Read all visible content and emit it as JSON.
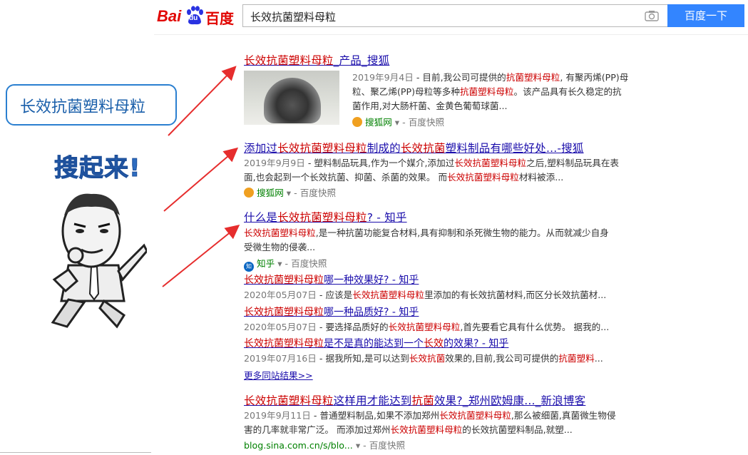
{
  "logo": {
    "bai": "Bai",
    "du": "du",
    "cn": "百度"
  },
  "search": {
    "query": "长效抗菌塑料母粒",
    "button": "百度一下"
  },
  "side": {
    "bubble": "长效抗菌塑料母粒",
    "meme_text": "搜起来!"
  },
  "results": {
    "r1": {
      "title": [
        "长效抗菌塑料母粒",
        "_产品_搜狐"
      ],
      "line1": [
        "2019年9月4日",
        " - 目前,我公司可提供的",
        "抗菌塑料母粒",
        ", 有聚丙烯(PP)母"
      ],
      "line2": [
        "粒、聚乙烯(PP)母粒等多种",
        "抗菌塑料母粒",
        "。该产品具有长久稳定的抗"
      ],
      "line3": "菌作用,对大肠杆菌、金黄色葡萄球菌...",
      "source": "搜狐网",
      "snapshot": "百度快照"
    },
    "r2": {
      "title": [
        "添加过",
        "长效抗菌塑料母粒",
        "制成的",
        "长效抗菌",
        "塑料制品有哪些好处...-搜狐"
      ],
      "line1": [
        "2019年9月9日",
        " - 塑料制品玩具,作为一个媒介,添加过",
        "长效抗菌塑料母粒",
        "之后,塑料制品玩具在表"
      ],
      "line2": [
        "面,也会起到一个长效抗菌、抑菌、杀菌的效果。 而",
        "长效抗菌塑料母粒",
        "材料被添..."
      ],
      "source": "搜狐网",
      "snapshot": "百度快照"
    },
    "r3": {
      "title": [
        "什么是",
        "长效抗菌塑料母粒",
        "? - 知乎"
      ],
      "line1": [
        "长效抗菌塑料母粒",
        ",是一种抗菌功能复合材料,具有抑制和杀死微生物的能力。从而就减少自身"
      ],
      "line2": "受微生物的侵袭...",
      "source": "知乎",
      "snapshot": "百度快照",
      "subs": [
        {
          "title": [
            "长效抗菌塑料母粒",
            "哪一种效果好? - 知乎"
          ],
          "snip": [
            "2020年05月07日",
            " - 应该是",
            "长效抗菌塑料母粒",
            "里添加的有长效抗菌材料,而区分长效抗菌材..."
          ]
        },
        {
          "title": [
            "长效抗菌塑料母粒",
            "哪一种品质好? - 知乎"
          ],
          "snip": [
            "2020年05月07日",
            " - 要选择品质好的",
            "长效抗菌塑料母粒",
            ",首先要看它具有什么优势。 据我的..."
          ]
        },
        {
          "title": [
            "长效抗菌塑料母粒",
            "是不是真的能达到一个",
            "长效",
            "的效果? - 知乎"
          ],
          "snip": [
            "2019年07月16日",
            " - 据我所知,是可以达到",
            "长效抗菌",
            "效果的,目前,我公司可提供的",
            "抗菌塑料",
            "..."
          ]
        }
      ],
      "more": "更多同站结果>>"
    },
    "r4": {
      "title": [
        "长效抗菌塑料母粒",
        "这样用才能达到",
        "抗菌",
        "效果?_郑州欧姆康..._新浪博客"
      ],
      "line1": [
        "2019年9月11日",
        " - 普通塑料制品,如果不添加郑州",
        "长效抗菌塑料母粒",
        ",那么被细菌,真菌微生物侵"
      ],
      "line2": [
        "害的几率就非常广泛。 而添加过郑州",
        "长效抗菌塑料母粒",
        "的长效抗菌塑料制品,就塑..."
      ],
      "url": "blog.sina.com.cn/s/blo...",
      "snapshot": "百度快照"
    }
  },
  "colors": {
    "link": "#1a0dab",
    "highlight": "#cc0000",
    "accent": "#3385ff",
    "arrow": "#e62d2d",
    "bubble_border": "#2a7fd0"
  }
}
